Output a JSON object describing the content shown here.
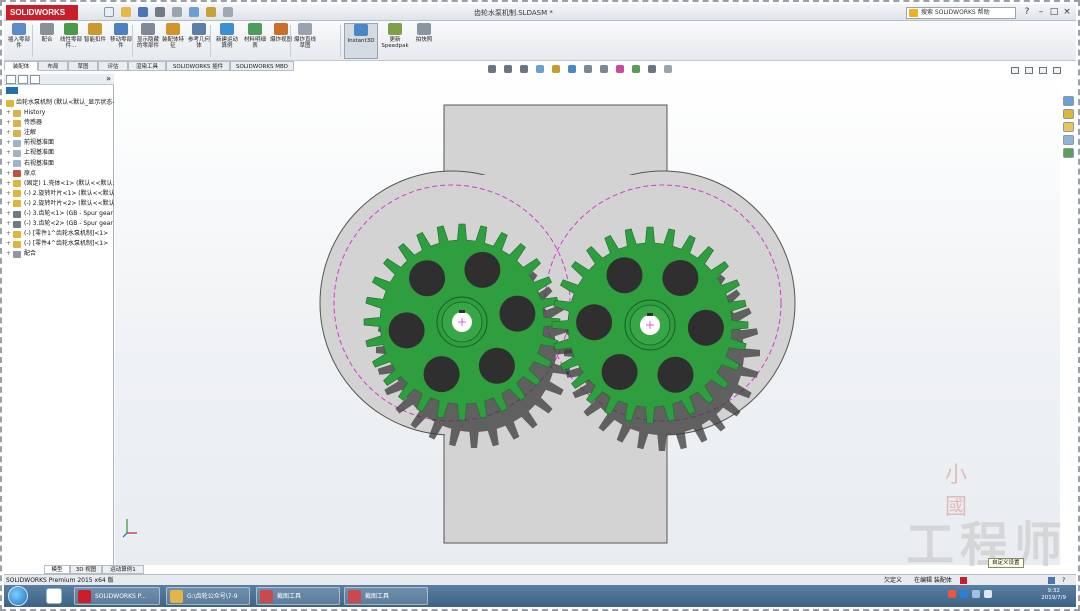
{
  "app": {
    "logo": "SOLIDWORKS",
    "document_title": "齿轮水泵机制.SLDASM *",
    "search_placeholder": "搜索 SOLIDWORKS 帮助"
  },
  "command_manager": {
    "buttons": [
      {
        "label": "插入零部件",
        "icon": "insert-component-icon",
        "color": "#5b8cc9"
      },
      {
        "label": "配合",
        "icon": "mate-icon",
        "color": "#8a8f96"
      },
      {
        "label": "线性零部件...",
        "icon": "linear-pattern-icon",
        "color": "#4a9a4a"
      },
      {
        "label": "智能扣件",
        "icon": "smart-fastener-icon",
        "color": "#c79b2e"
      },
      {
        "label": "移动零部件",
        "icon": "move-component-icon",
        "color": "#4f7fc0"
      },
      {
        "label": "显示隐藏的零部件",
        "icon": "show-hidden-icon",
        "color": "#7f8a96"
      },
      {
        "label": "装配体特征",
        "icon": "assembly-feature-icon",
        "color": "#d0962a"
      },
      {
        "label": "参考几何体",
        "icon": "reference-geometry-icon",
        "color": "#5d7fa6"
      },
      {
        "label": "新建运动算例",
        "icon": "new-motion-study-icon",
        "color": "#3c8fd0"
      },
      {
        "label": "材料明细表",
        "icon": "bom-icon",
        "color": "#4f9c5a"
      },
      {
        "label": "爆炸视图",
        "icon": "exploded-view-icon",
        "color": "#c96f2e"
      },
      {
        "label": "爆炸直线草图",
        "icon": "explode-line-icon",
        "color": "#9aa3ad"
      },
      {
        "label": "Instant3D",
        "icon": "instant3d-icon",
        "color": "#4a86c8"
      },
      {
        "label": "更新Speedpak",
        "icon": "speedpak-icon",
        "color": "#7fa04a"
      },
      {
        "label": "拍快照",
        "icon": "snapshot-icon",
        "color": "#8a95a2"
      }
    ],
    "tabs": [
      "装配体",
      "布局",
      "草图",
      "评估",
      "渲染工具",
      "SOLIDWORKS 插件",
      "SOLIDWORKS MBD"
    ]
  },
  "feature_tree": {
    "root": "齿轮水泵机制 (默认<默认_显示状态-1>)",
    "items": [
      {
        "label": "History",
        "icon": "history-icon",
        "color": "#d8b24a"
      },
      {
        "label": "传感器",
        "icon": "sensor-icon",
        "color": "#d8b24a"
      },
      {
        "label": "注解",
        "icon": "annotation-icon",
        "color": "#d8b24a"
      },
      {
        "label": "前视基准面",
        "icon": "plane-icon",
        "color": "#9fb2c6"
      },
      {
        "label": "上视基准面",
        "icon": "plane-icon",
        "color": "#9fb2c6"
      },
      {
        "label": "右视基准面",
        "icon": "plane-icon",
        "color": "#9fb2c6"
      },
      {
        "label": "原点",
        "icon": "origin-icon",
        "color": "#c0503f"
      },
      {
        "label": "(固定) 1.壳体<1> (默认<<默认>_显示",
        "icon": "part-icon",
        "color": "#e0b63a"
      },
      {
        "label": "(-) 2.旋转叶片<1> (默认<<默认>_显",
        "icon": "part-icon",
        "color": "#e0b63a"
      },
      {
        "label": "(-) 2.旋转叶片<2> (默认<<默认>_显",
        "icon": "part-icon",
        "color": "#e0b63a"
      },
      {
        "label": "(-) 3.齿轮<1> (GB - Spur gear",
        "icon": "gear-part-icon",
        "color": "#6e7a86"
      },
      {
        "label": "(-) 3.齿轮<2> (GB - Spur gear",
        "icon": "gear-part-icon",
        "color": "#6e7a86"
      },
      {
        "label": "(-) [零件1^齿轮水泵机制]<1>",
        "icon": "part-icon",
        "color": "#e0b63a"
      },
      {
        "label": "(-) [零件4^齿轮水泵机制]<1>",
        "icon": "part-icon",
        "color": "#e0b63a"
      },
      {
        "label": "配合",
        "icon": "mates-folder-icon",
        "color": "#8f98a3"
      }
    ]
  },
  "bottom_tabs": [
    "模型",
    "3D 视图",
    "运动算例1"
  ],
  "tooltip": "自定义设置",
  "watermark": {
    "top": "小 國",
    "bottom": "工程师"
  },
  "status": {
    "left": "SOLIDWORKS Premium 2015 x64 版",
    "mid": "欠定义",
    "edit": "在编辑 装配体"
  },
  "taskbar": {
    "items": [
      {
        "label": "SOLIDWORKS P...",
        "icon": "solidworks-icon",
        "color": "#c8202a"
      },
      {
        "label": "G:\\齿轮公众号\\7-9",
        "icon": "folder-icon",
        "color": "#e2b44a"
      },
      {
        "label": "截图工具",
        "icon": "snipping-tool-icon",
        "color": "#c94a4a"
      },
      {
        "label": "截图工具",
        "icon": "snipping-tool-icon",
        "color": "#c94a4a"
      }
    ],
    "time": "9:32",
    "date": "2019/7/9"
  },
  "colors": {
    "gear": "#2e9e3e",
    "housing": "#d3d3d3",
    "pitch_circle": "#d23cc8",
    "accent": "#c8202a"
  }
}
